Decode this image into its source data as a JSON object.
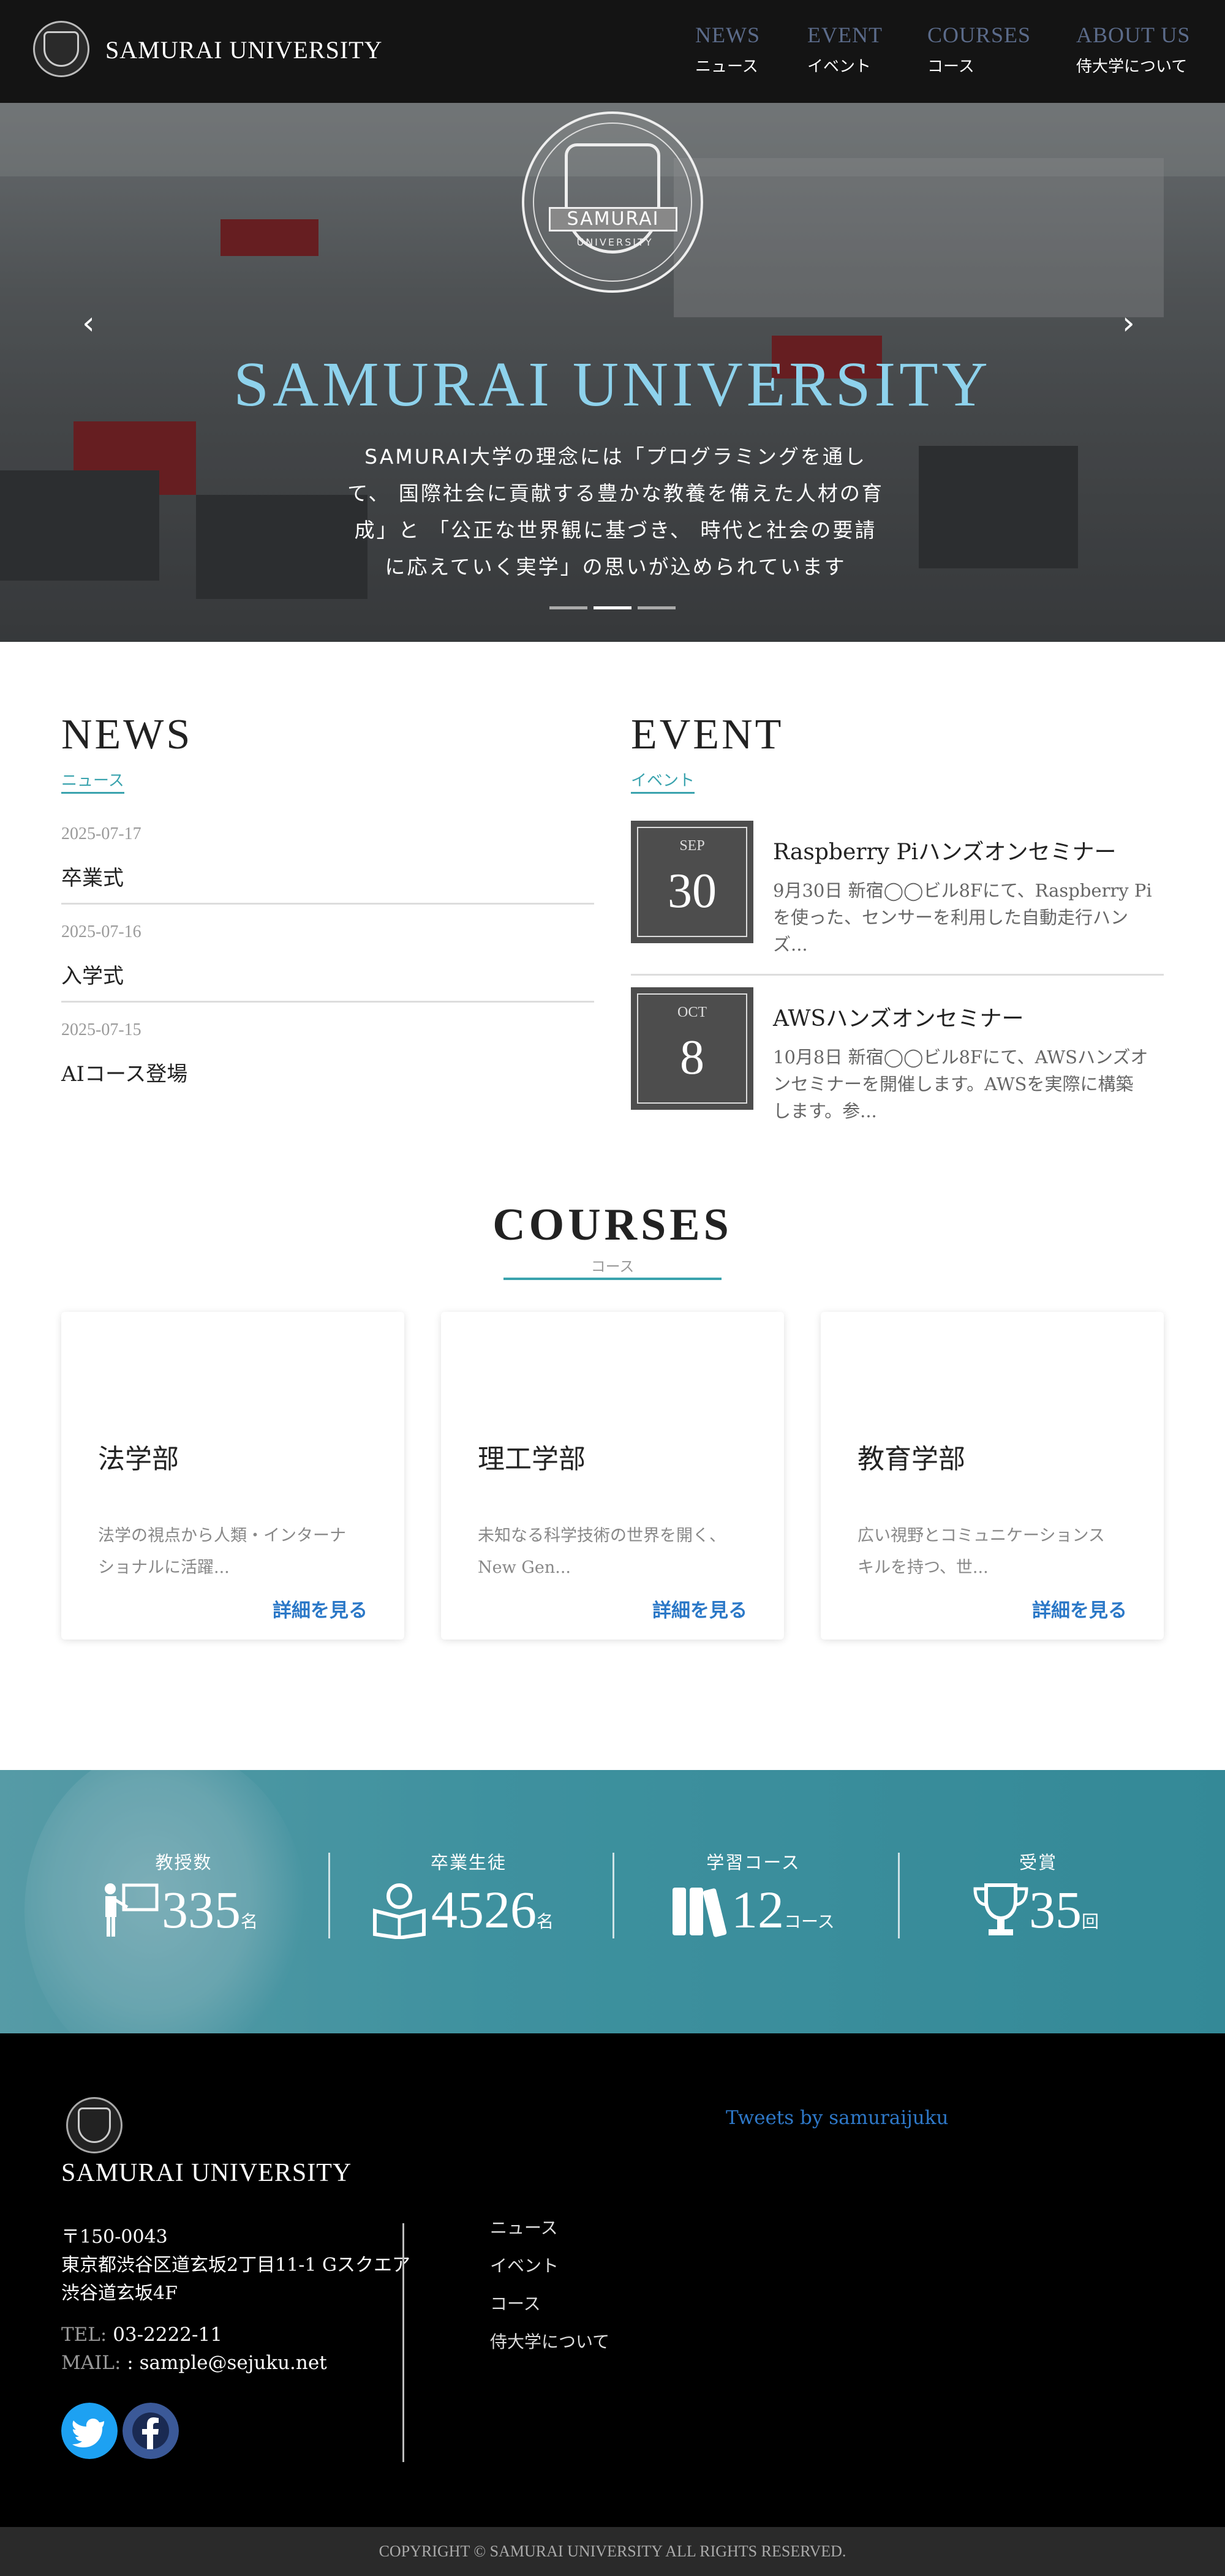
{
  "header": {
    "logo_text": "SAMURAI UNIVERSITY",
    "nav": [
      {
        "en": "NEWS",
        "ja": "ニュース"
      },
      {
        "en": "EVENT",
        "ja": "イベント"
      },
      {
        "en": "COURSES",
        "ja": "コース"
      },
      {
        "en": "ABOUT US",
        "ja": "侍大学について"
      }
    ]
  },
  "hero": {
    "emblem_text": "SAMURAI",
    "emblem_subtext": "UNIVERSITY",
    "title": "SAMURAI UNIVERSITY",
    "text_lines": [
      "SAMURAI大学の理念には「プログラミングを通し",
      "て、 国際社会に貢献する豊かな教養を備えた人材の育",
      "成」と 「公正な世界観に基づき、 時代と社会の要請",
      "に応えていく実学」の思いが込められています"
    ],
    "prev_arrow": "‹",
    "next_arrow": "›",
    "active_slide": 2,
    "slide_count": 3
  },
  "news": {
    "title": "NEWS",
    "subtitle": "ニュース",
    "items": [
      {
        "date": "2025-07-17",
        "title": "卒業式"
      },
      {
        "date": "2025-07-16",
        "title": "入学式"
      },
      {
        "date": "2025-07-15",
        "title": "AIコース登場"
      }
    ]
  },
  "event": {
    "title": "EVENT",
    "subtitle": "イベント",
    "items": [
      {
        "month": "SEP",
        "day": "30",
        "title": "Raspberry Piハンズオンセミナー",
        "desc_lines": [
          "9月30日 新宿◯◯ビル8Fにて、Raspberry Pi",
          "を使った、センサーを利用した自動走行ハン",
          "ズ..."
        ]
      },
      {
        "month": "OCT",
        "day": "8",
        "title": "AWSハンズオンセミナー",
        "desc_lines": [
          "10月8日 新宿◯◯ビル8Fにて、AWSハンズオ",
          "ンセミナーを開催します。AWSを実際に構築",
          "します。参..."
        ]
      }
    ]
  },
  "courses": {
    "title": "COURSES",
    "subtitle": "コース",
    "link_label": "詳細を見る",
    "items": [
      {
        "title": "法学部",
        "desc_lines": [
          "法学の視点から人類・インターナ",
          "ショナルに活躍..."
        ]
      },
      {
        "title": "理工学部",
        "desc_lines": [
          "未知なる科学技術の世界を開く、",
          "New Gen..."
        ]
      },
      {
        "title": "教育学部",
        "desc_lines": [
          "広い視野とコミュニケーションス",
          "キルを持つ、世..."
        ]
      }
    ]
  },
  "stats": [
    {
      "label": "教授数",
      "value": "335",
      "unit": "名",
      "icon": "teacher-icon"
    },
    {
      "label": "卒業生徒",
      "value": "4526",
      "unit": "名",
      "icon": "reader-icon"
    },
    {
      "label": "学習コース",
      "value": "12",
      "unit": "コース",
      "icon": "books-icon"
    },
    {
      "label": "受賞",
      "value": "35",
      "unit": "回",
      "icon": "trophy-icon"
    }
  ],
  "footer": {
    "name": "SAMURAI UNIVERSITY",
    "address_lines": [
      "〒150-0043",
      "東京都渋谷区道玄坂2丁目11-1 Gスクエア",
      "渋谷道玄坂4F"
    ],
    "tel_label": "TEL:",
    "tel": "03-2222-11",
    "mail_label": "MAIL:",
    "mail": ": sample@sejuku.net",
    "nav": [
      "ニュース",
      "イベント",
      "コース",
      "侍大学について"
    ],
    "tweets_link": "Tweets by samuraijuku",
    "copyright": "COPYRIGHT © SAMURAI UNIVERSITY ALL RIGHTS RESERVED."
  },
  "colors": {
    "accent": "#3aa3ae",
    "hero_title": "#8ed2ec",
    "link": "#2b78c7",
    "twitter": "#1da1f2",
    "facebook": "#3b5998",
    "header_bg": "#141414",
    "footer_bg": "#000000"
  }
}
